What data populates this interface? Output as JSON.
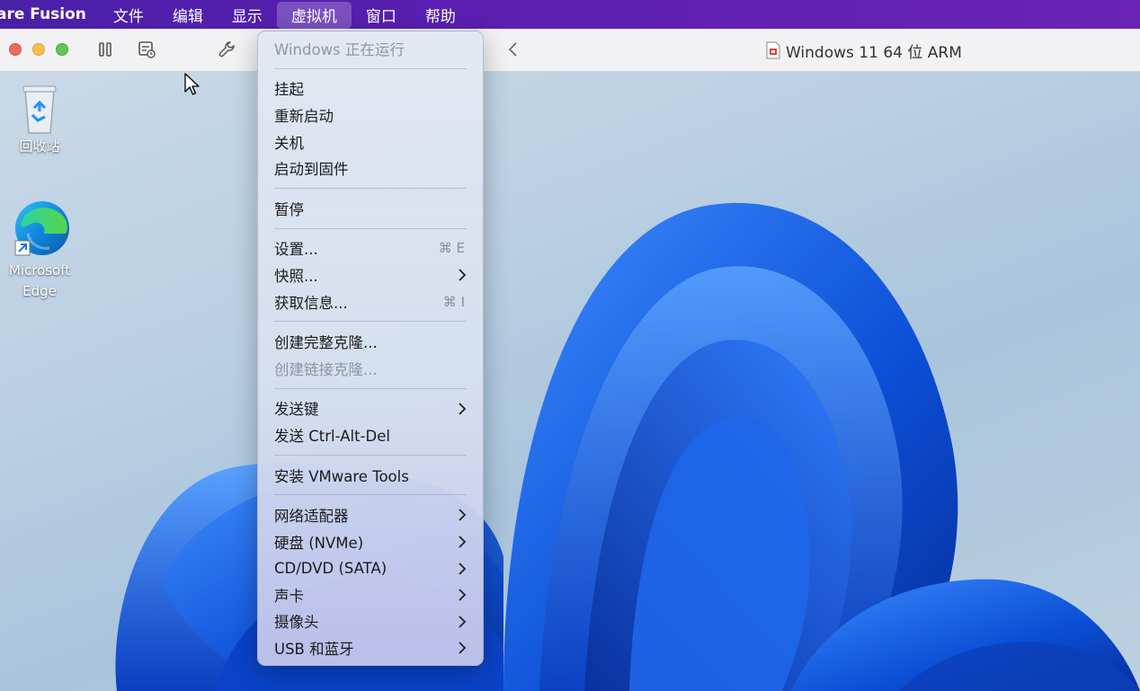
{
  "menubar": {
    "app_name": "are Fusion",
    "menus": [
      "文件",
      "编辑",
      "显示",
      "虚拟机",
      "窗口",
      "帮助"
    ],
    "active_index": 3
  },
  "toolbar": {
    "window_title": "Windows 11 64 位 ARM"
  },
  "desktop": {
    "recycle_bin_label": "回收站",
    "edge_label_line1": "Microsoft",
    "edge_label_line2": "Edge"
  },
  "vm_menu": {
    "status": "Windows 正在运行",
    "suspend": "挂起",
    "restart": "重新启动",
    "shutdown": "关机",
    "boot_firmware": "启动到固件",
    "pause": "暂停",
    "settings": "设置...",
    "settings_shortcut": "⌘ E",
    "snapshots": "快照...",
    "get_info": "获取信息...",
    "get_info_shortcut": "⌘ I",
    "full_clone": "创建完整克隆...",
    "linked_clone": "创建链接克隆...",
    "send_key": "发送键",
    "send_cad": "发送 Ctrl-Alt-Del",
    "install_tools": "安装 VMware Tools",
    "network_adapter": "网络适配器",
    "hard_disk": "硬盘 (NVMe)",
    "cd_dvd": "CD/DVD (SATA)",
    "sound_card": "声卡",
    "camera": "摄像头",
    "usb_bluetooth": "USB 和蓝牙"
  },
  "colors": {
    "menubar": "#5a1fb0",
    "bloom_dark": "#0a3fc0",
    "bloom_light": "#3d8bff"
  }
}
